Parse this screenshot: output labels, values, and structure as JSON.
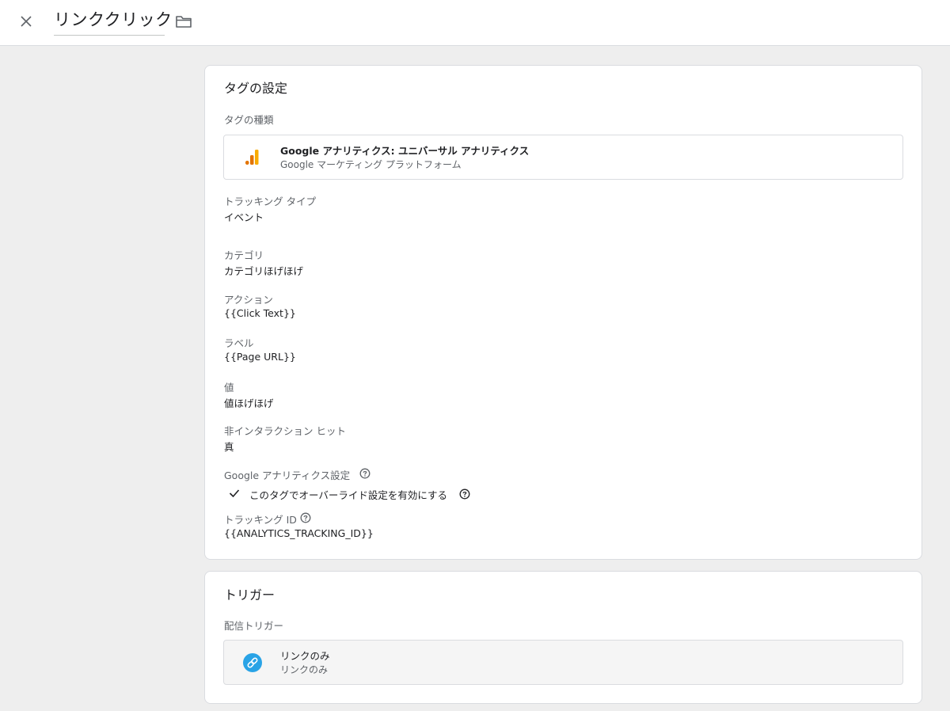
{
  "header": {
    "title": "リンククリック"
  },
  "tag_config": {
    "card_title": "タグの設定",
    "tag_type_label": "タグの種類",
    "tag_type": {
      "name": "Google アナリティクス: ユニバーサル アナリティクス",
      "provider": "Google マーケティング プラットフォーム"
    },
    "fields": [
      {
        "label": "トラッキング タイプ",
        "value": "イベント"
      },
      {
        "label": "カテゴリ",
        "value": "カテゴリほげほげ"
      },
      {
        "label": "アクション",
        "value": "{{Click Text}}"
      },
      {
        "label": "ラベル",
        "value": "{{Page URL}}"
      },
      {
        "label": "値",
        "value": "値ほげほげ"
      },
      {
        "label": "非インタラクション ヒット",
        "value": "真"
      }
    ],
    "ga_settings_label": "Google アナリティクス設定",
    "override_text": "このタグでオーバーライド設定を有効にする",
    "tracking_id_label": "トラッキング ID",
    "tracking_id_value": "{{ANALYTICS_TRACKING_ID}}"
  },
  "trigger": {
    "card_title": "トリガー",
    "firing_label": "配信トリガー",
    "item": {
      "name": "リンクのみ",
      "type": "リンクのみ"
    }
  },
  "colors": {
    "analytics_orange": "#f9ab00",
    "analytics_dark_orange": "#e37400",
    "link_blue": "#29a3e6"
  }
}
